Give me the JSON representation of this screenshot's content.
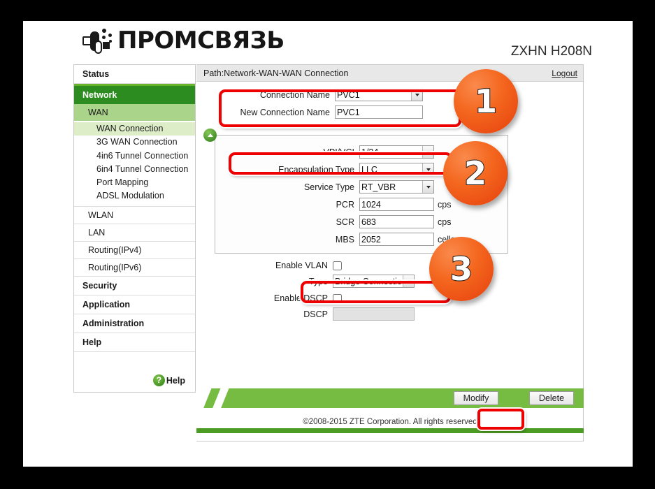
{
  "brand": {
    "name": "ПРОМСВЯЗЬ",
    "model": "ZXHN H208N",
    "logo_icon": "promsvyaz-logo-icon"
  },
  "sidebar": {
    "items": [
      {
        "label": "Status",
        "level": "top",
        "active": false
      },
      {
        "label": "Network",
        "level": "top",
        "active": true
      },
      {
        "label": "WAN",
        "level": "sub",
        "active": true
      },
      {
        "label": "WAN Connection",
        "level": "leaf",
        "active": true
      },
      {
        "label": "3G WAN Connection",
        "level": "leaf",
        "active": false
      },
      {
        "label": "4in6 Tunnel Connection",
        "level": "leaf",
        "active": false
      },
      {
        "label": "6in4 Tunnel Connection",
        "level": "leaf",
        "active": false
      },
      {
        "label": "Port Mapping",
        "level": "leaf",
        "active": false
      },
      {
        "label": "ADSL Modulation",
        "level": "leaf",
        "active": false
      },
      {
        "label": "WLAN",
        "level": "sub",
        "active": false
      },
      {
        "label": "LAN",
        "level": "sub",
        "active": false
      },
      {
        "label": "Routing(IPv4)",
        "level": "sub",
        "active": false
      },
      {
        "label": "Routing(IPv6)",
        "level": "sub",
        "active": false
      },
      {
        "label": "Security",
        "level": "top",
        "active": false
      },
      {
        "label": "Application",
        "level": "top",
        "active": false
      },
      {
        "label": "Administration",
        "level": "top",
        "active": false
      },
      {
        "label": "Help",
        "level": "top",
        "active": false
      }
    ],
    "help": {
      "label": "Help",
      "icon": "question-mark-icon",
      "glyph": "?"
    }
  },
  "content": {
    "path": "Path:Network-WAN-WAN Connection",
    "logout": "Logout",
    "collapse_icon": "chevron-up-icon"
  },
  "form": {
    "connection_name": {
      "label": "Connection Name",
      "value": "PVC1"
    },
    "new_connection_name": {
      "label": "New Connection Name",
      "value": "PVC1"
    },
    "vpi_vci": {
      "label": "VPI/VCI",
      "value": "1/34"
    },
    "encapsulation_type": {
      "label": "Encapsulation Type",
      "value": "LLC"
    },
    "service_type": {
      "label": "Service Type",
      "value": "RT_VBR"
    },
    "pcr": {
      "label": "PCR",
      "value": "1024",
      "unit": "cps"
    },
    "scr": {
      "label": "SCR",
      "value": "683",
      "unit": "cps"
    },
    "mbs": {
      "label": "MBS",
      "value": "2052",
      "unit": "cells"
    },
    "enable_vlan": {
      "label": "Enable VLAN",
      "checked": false
    },
    "type": {
      "label": "Type",
      "value": "Bridge Connection"
    },
    "enable_dscp": {
      "label": "Enable DSCP",
      "checked": false
    },
    "dscp": {
      "label": "DSCP",
      "value": "",
      "disabled": true
    }
  },
  "footer": {
    "modify_label": "Modify",
    "delete_label": "Delete",
    "copyright": "©2008-2015 ZTE Corporation. All rights reserved"
  },
  "annotations": {
    "badges": [
      "1",
      "2",
      "3"
    ],
    "highlight_color": "#ee0000",
    "badge_color": "#f4671f"
  }
}
